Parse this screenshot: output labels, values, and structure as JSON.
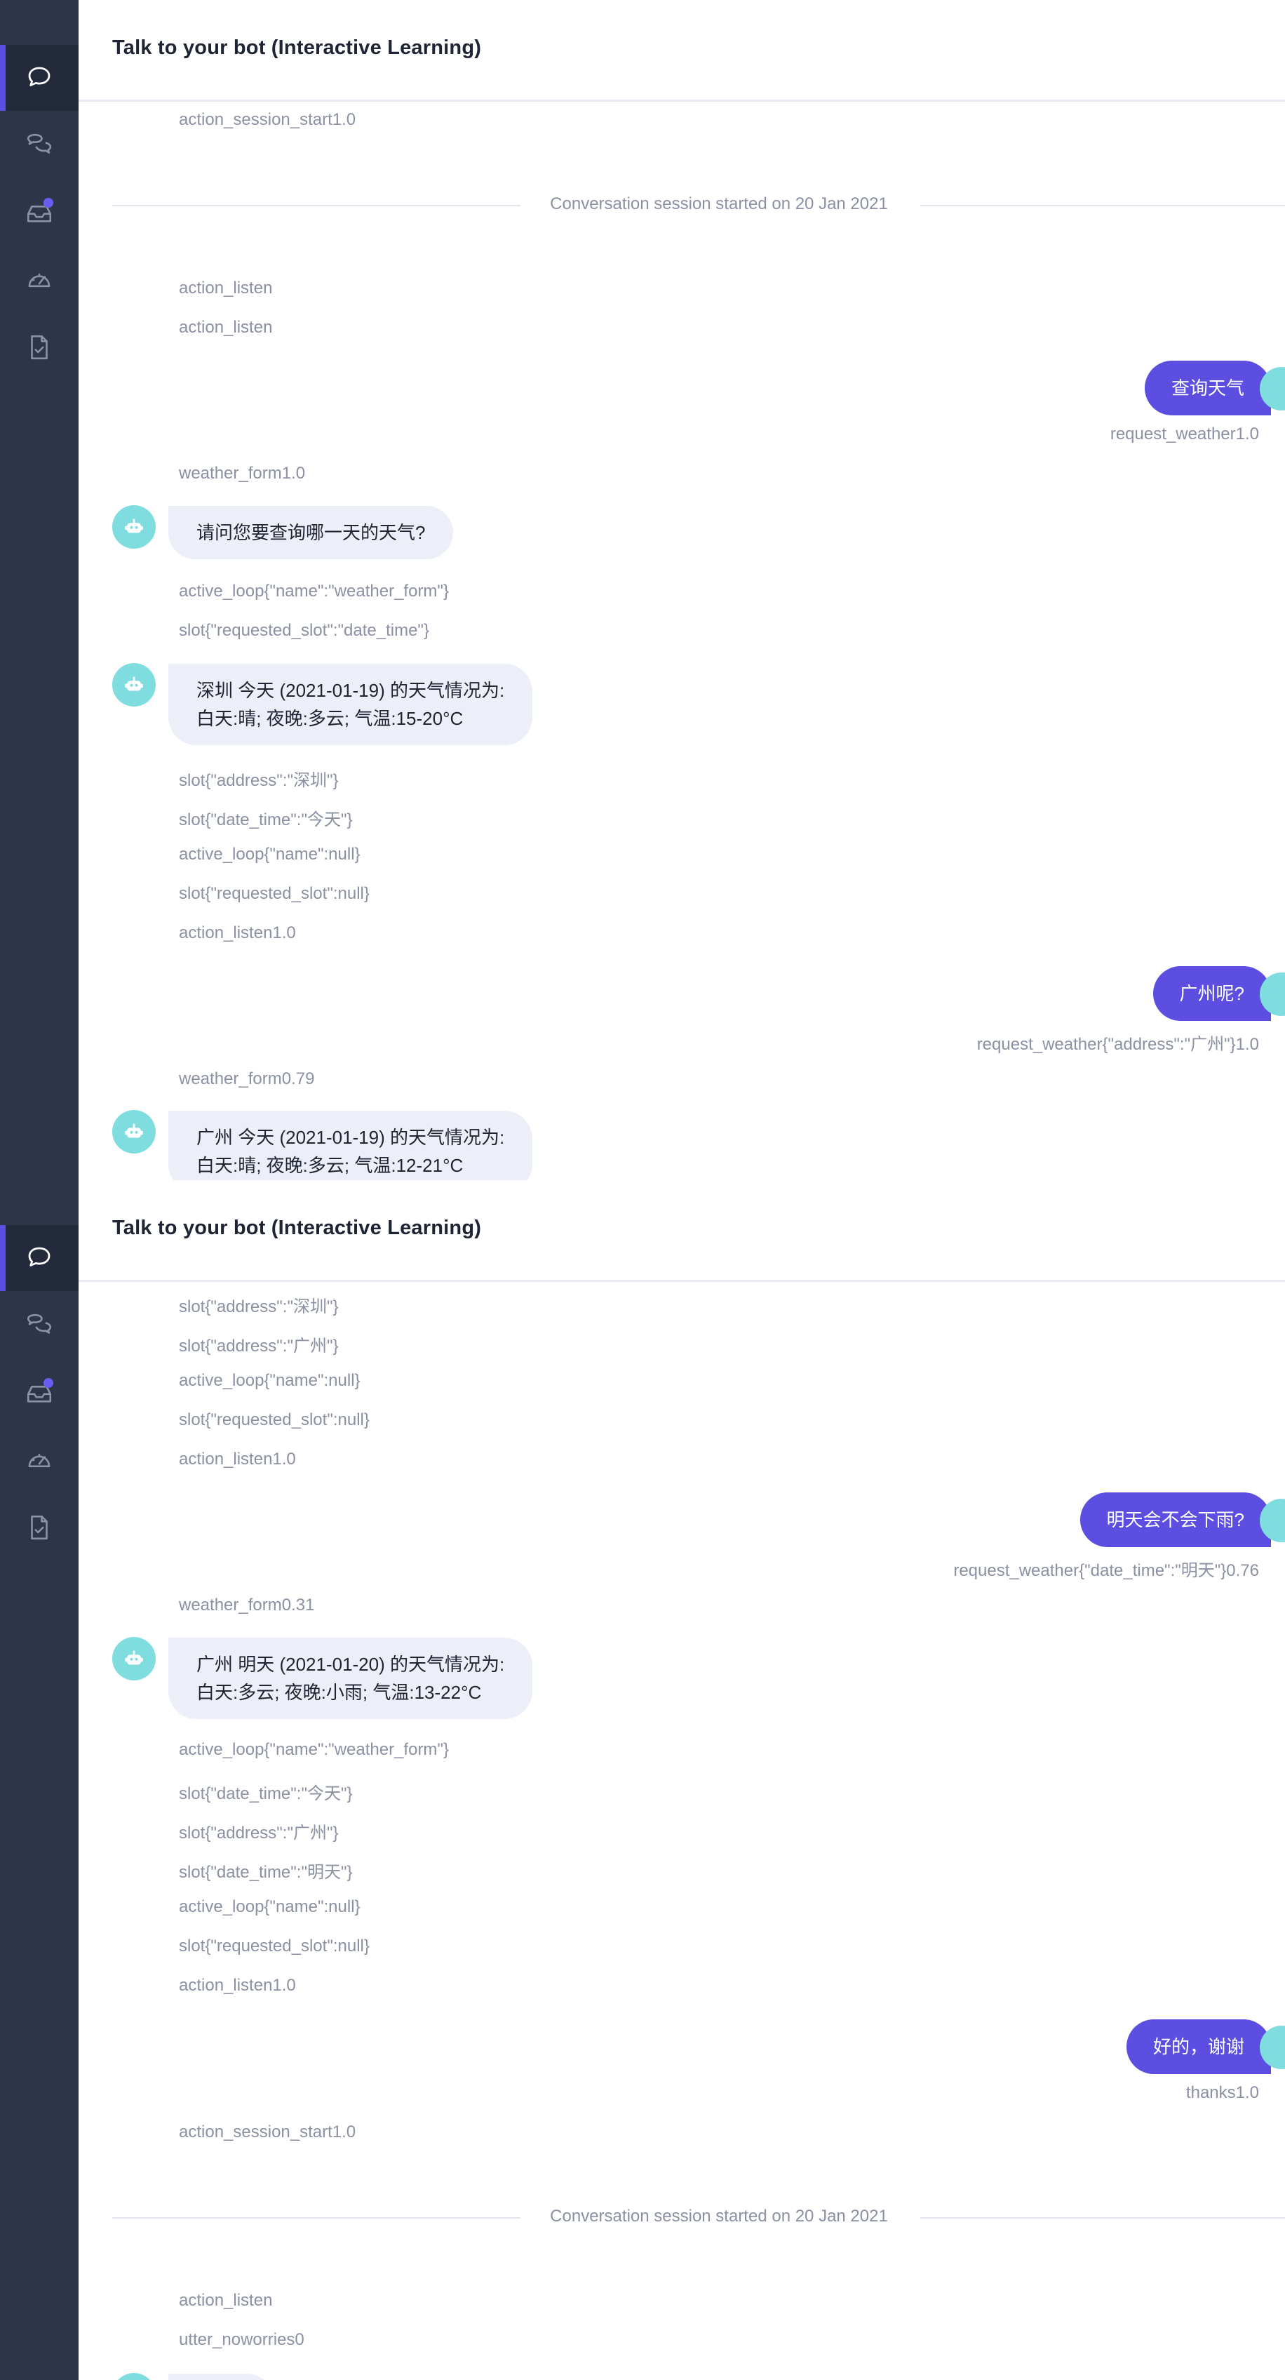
{
  "app": {
    "title": "Talk to your bot (Interactive Learning)"
  },
  "sidebar": {
    "items": [
      {
        "icon": "chat-bubble-icon",
        "active": true
      },
      {
        "icon": "conversations-icon",
        "active": false
      },
      {
        "icon": "inbox-icon",
        "active": false,
        "badge": true
      },
      {
        "icon": "gauge-icon",
        "active": false
      },
      {
        "icon": "checklist-icon",
        "active": false
      }
    ]
  },
  "panel1": {
    "events": [
      "action_session_start1.0",
      "action_listen",
      "action_listen",
      "weather_form1.0",
      "active_loop{\"name\":\"weather_form\"}",
      "slot{\"requested_slot\":\"date_time\"}",
      "slot{\"address\":\"深圳\"}",
      "slot{\"date_time\":\"今天\"}",
      "active_loop{\"name\":null}",
      "slot{\"requested_slot\":null}",
      "action_listen1.0",
      "weather_form0.79"
    ],
    "separator": "Conversation session started on 20 Jan 2021",
    "user_messages": [
      {
        "text": "查询天气",
        "intent": "request_weather1.0"
      },
      {
        "text": "广州呢?",
        "intent": "request_weather{\"address\":\"广州\"}1.0"
      }
    ],
    "bot_messages": [
      {
        "lines": [
          "请问您要查询哪一天的天气?"
        ]
      },
      {
        "lines": [
          "深圳 今天 (2021-01-19) 的天气情况为:",
          "白天:晴; 夜晚:多云; 气温:15-20°C"
        ]
      },
      {
        "lines": [
          "广州 今天 (2021-01-19) 的天气情况为:",
          "白天:晴; 夜晚:多云; 气温:12-21°C"
        ]
      }
    ]
  },
  "panel2": {
    "events": [
      "slot{\"address\":\"深圳\"}",
      "slot{\"address\":\"广州\"}",
      "active_loop{\"name\":null}",
      "slot{\"requested_slot\":null}",
      "action_listen1.0",
      "weather_form0.31",
      "active_loop{\"name\":\"weather_form\"}",
      "slot{\"date_time\":\"今天\"}",
      "slot{\"address\":\"广州\"}",
      "slot{\"date_time\":\"明天\"}",
      "active_loop{\"name\":null}",
      "slot{\"requested_slot\":null}",
      "action_listen1.0",
      "action_session_start1.0",
      "action_listen",
      "utter_noworries0"
    ],
    "separator": "Conversation session started on 20 Jan 2021",
    "user_messages": [
      {
        "text": "明天会不会下雨?",
        "intent": "request_weather{\"date_time\":\"明天\"}0.76"
      },
      {
        "text": "好的，谢谢",
        "intent": "thanks1.0"
      }
    ],
    "bot_messages": [
      {
        "lines": [
          "广州 明天 (2021-01-20) 的天气情况为:",
          "白天:多云; 夜晚:小雨; 气温:13-22°C"
        ]
      }
    ]
  }
}
